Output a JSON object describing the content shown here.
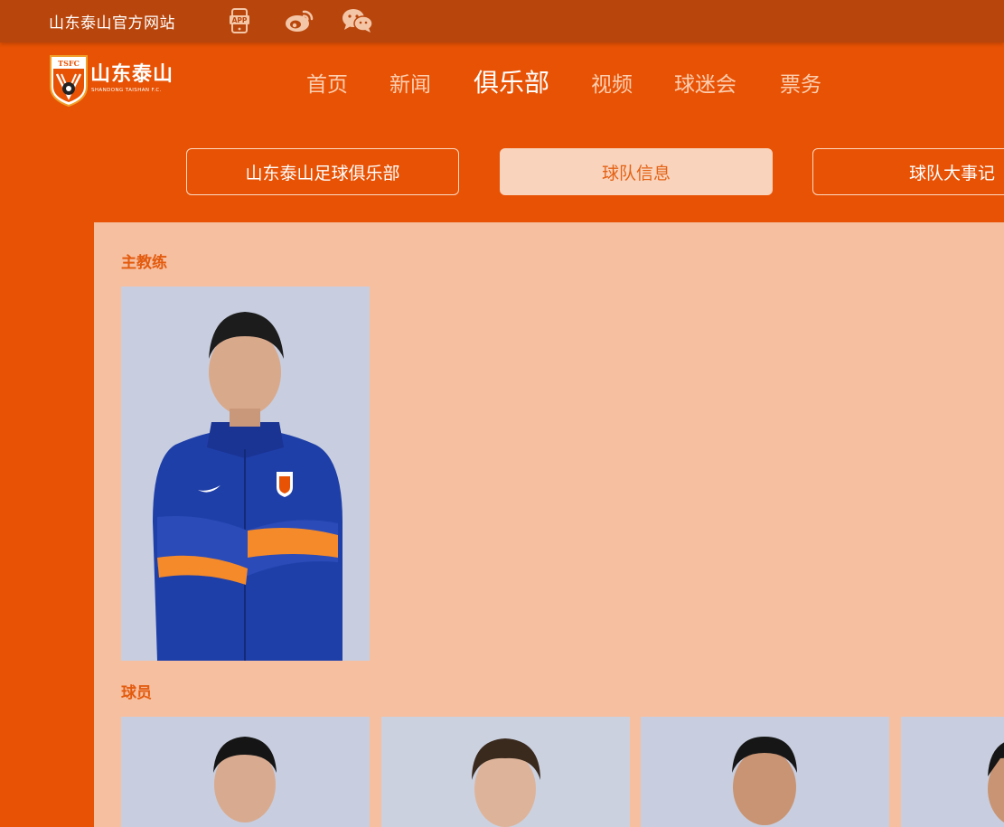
{
  "topbar": {
    "site_name": "山东泰山官方网站",
    "icons": [
      "app-icon",
      "weibo-icon",
      "wechat-icon"
    ],
    "app_label": "APP"
  },
  "logo": {
    "badge_text": "TSFC",
    "name": "山东泰山",
    "subtitle": "SHANDONG TAISHAN F.C."
  },
  "nav": {
    "items": [
      {
        "label": "首页"
      },
      {
        "label": "新闻"
      },
      {
        "label": "俱乐部",
        "active": true
      },
      {
        "label": "视频"
      },
      {
        "label": "球迷会"
      },
      {
        "label": "票务"
      }
    ]
  },
  "subtabs": [
    {
      "label": "山东泰山足球俱乐部"
    },
    {
      "label": "球队信息",
      "active": true
    },
    {
      "label": "球队大事记"
    }
  ],
  "sections": {
    "head_coach": "主教练",
    "players": "球员"
  },
  "colors": {
    "page_orange": "#e85204",
    "topbar": "#b8460c",
    "content_bg": "#f6bfa0",
    "section_title": "#e35b0e",
    "active_tab_bg": "#f9d3bc",
    "jersey_blue": "#1f3fa8"
  }
}
